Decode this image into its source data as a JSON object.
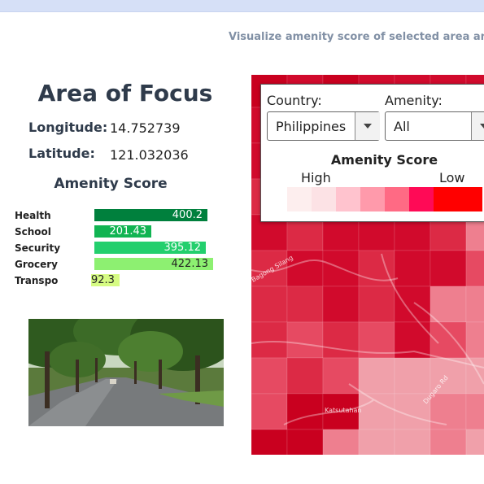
{
  "header": {
    "tagline": "Visualize amenity score of selected area an"
  },
  "focus": {
    "title": "Area of Focus",
    "longitude_label": "Longitude:",
    "longitude_value": "14.752739",
    "latitude_label": "Latitude:",
    "latitude_value": "121.032036"
  },
  "amenity_chart": {
    "title": "Amenity Score",
    "bars": [
      {
        "label": "Health",
        "value_text": "400.2",
        "value": 400.2,
        "color": "#00803d",
        "text_color": "#ffffff"
      },
      {
        "label": "School",
        "value_text": "201.43",
        "value": 201.43,
        "color": "#11b452",
        "text_color": "#ffffff"
      },
      {
        "label": "Security",
        "value_text": "395.12",
        "value": 395.12,
        "color": "#23cf6d",
        "text_color": "#ffffff"
      },
      {
        "label": "Grocery",
        "value_text": "422.13",
        "value": 422.13,
        "color": "#8df071",
        "text_color": "#222222"
      },
      {
        "label": "Transpo",
        "value_text": "92.3",
        "value": 92.3,
        "color": "#d6fb83",
        "text_color": "#222222"
      }
    ]
  },
  "photo": {
    "subject": "tree-lined-street-photo"
  },
  "map_panel": {
    "country_label": "Country:",
    "country_value": "Philippines",
    "amenity_label": "Amenity:",
    "amenity_value": "All",
    "legend_title": "Amenity Score",
    "legend_high": "High",
    "legend_low": "Low",
    "legend_colors": [
      "#fdeeee",
      "#fce2e5",
      "#ffc3ce",
      "#ff9aab",
      "#ff6a84",
      "#ff0a56",
      "#ff0000",
      "#ff0000"
    ]
  },
  "map_labels": [
    {
      "text": "Bagong Silang"
    },
    {
      "text": "Katsutahan"
    },
    {
      "text": "Dugaro Rd"
    }
  ]
}
